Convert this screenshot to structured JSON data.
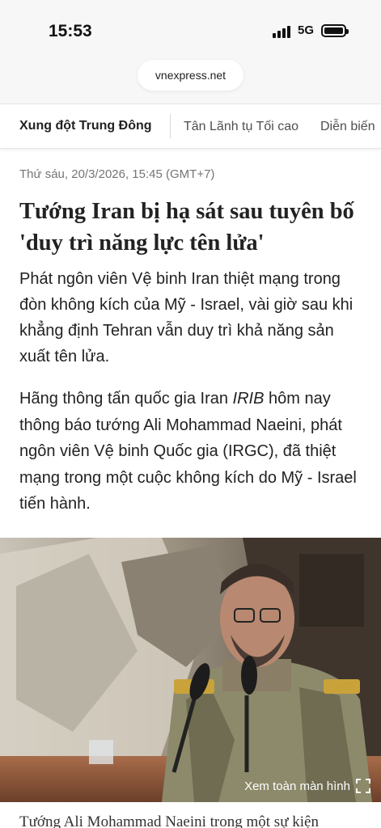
{
  "status_bar": {
    "time": "15:53",
    "network": "5G",
    "icons": [
      "signal-icon",
      "battery-icon"
    ]
  },
  "browser": {
    "url": "vnexpress.net"
  },
  "topics": {
    "main": "Xung đột Trung Đông",
    "items": [
      "Tân Lãnh tụ Tối cao",
      "Diễn biến"
    ]
  },
  "article": {
    "date": "Thứ sáu, 20/3/2026, 15:45 (GMT+7)",
    "title": "Tướng Iran bị hạ sát sau tuyên bố 'duy trì năng lực tên lửa'",
    "lead": "Phát ngôn viên Vệ binh Iran thiệt mạng trong đòn không kích của Mỹ - Israel, vài giờ sau khi khẳng định Tehran vẫn duy trì khả năng sản xuất tên lửa.",
    "para_1_before": "Hãng thông tấn quốc gia Iran ",
    "para_1_em": "IRIB",
    "para_1_after": " hôm nay thông báo tướng Ali Mohammad Naeini, phát ngôn viên Vệ binh Quốc gia (IRGC), đã thiệt mạng trong một cuộc không kích do Mỹ - Israel tiến hành.",
    "photo": {
      "fullscreen_label": "Xem toàn màn hình",
      "fullscreen_icon": "expand-icon"
    },
    "caption": "Tướng Ali Mohammad Naeini trong một sự kiện"
  }
}
